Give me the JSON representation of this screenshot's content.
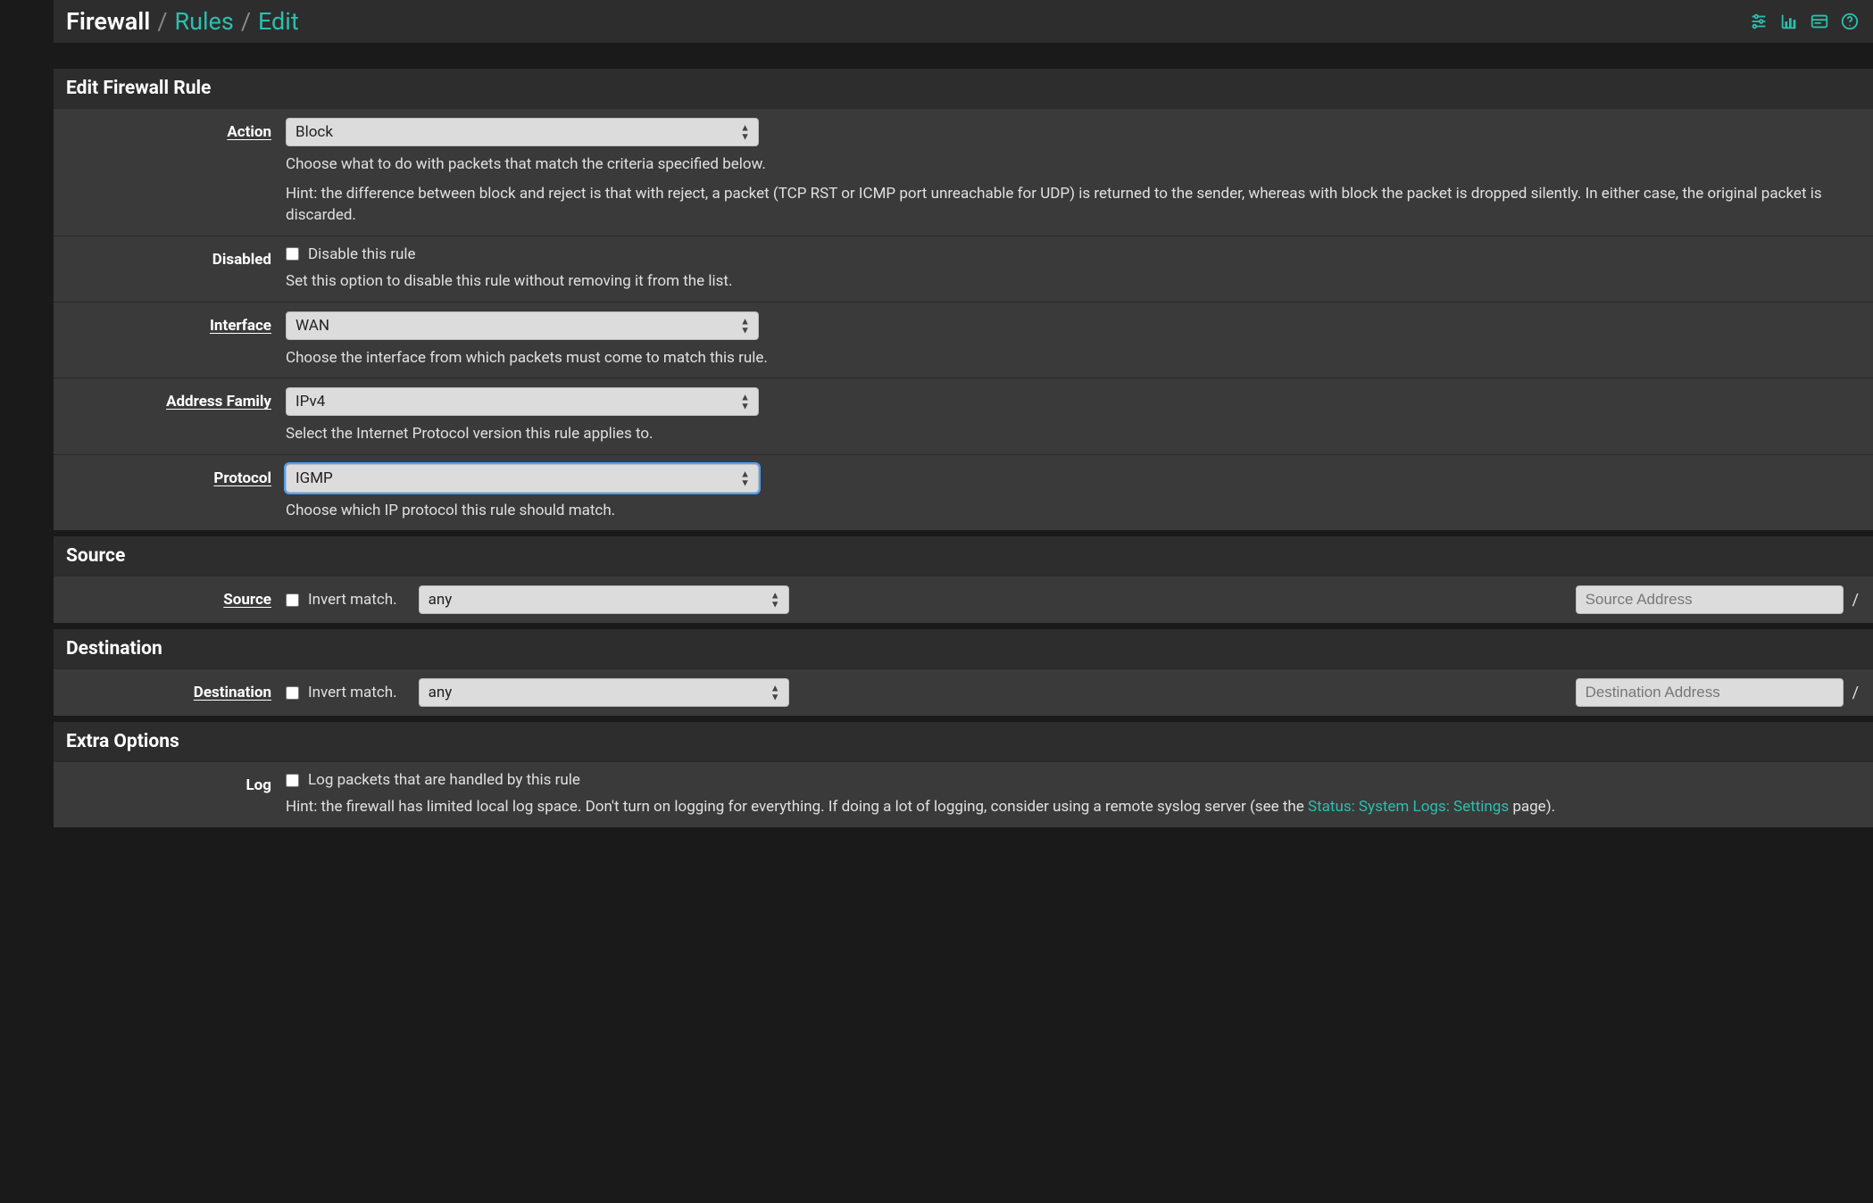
{
  "breadcrumb": {
    "root": "Firewall",
    "rules": "Rules",
    "edit": "Edit"
  },
  "panels": {
    "edit_rule": "Edit Firewall Rule",
    "source": "Source",
    "destination": "Destination",
    "extra_options": "Extra Options"
  },
  "labels": {
    "action": "Action",
    "disabled": "Disabled",
    "interface": "Interface",
    "address_family": "Address Family",
    "protocol": "Protocol",
    "source": "Source",
    "destination": "Destination",
    "log": "Log"
  },
  "action": {
    "value": "Block",
    "help": "Choose what to do with packets that match the criteria specified below.",
    "hint": "Hint: the difference between block and reject is that with reject, a packet (TCP RST or ICMP port unreachable for UDP) is returned to the sender, whereas with block the packet is dropped silently. In either case, the original packet is discarded."
  },
  "disabled": {
    "checkbox_label": "Disable this rule",
    "help": "Set this option to disable this rule without removing it from the list."
  },
  "interface": {
    "value": "WAN",
    "help": "Choose the interface from which packets must come to match this rule."
  },
  "address_family": {
    "value": "IPv4",
    "help": "Select the Internet Protocol version this rule applies to."
  },
  "protocol": {
    "value": "IGMP",
    "help": "Choose which IP protocol this rule should match."
  },
  "source": {
    "invert_label": "Invert match.",
    "type_value": "any",
    "address_placeholder": "Source Address"
  },
  "destination": {
    "invert_label": "Invert match.",
    "type_value": "any",
    "address_placeholder": "Destination Address"
  },
  "log": {
    "checkbox_label": "Log packets that are handled by this rule",
    "hint_before": "Hint: the firewall has limited local log space. Don't turn on logging for everything. If doing a lot of logging, consider using a remote syslog server (see the ",
    "link_text": "Status: System Logs: Settings",
    "hint_after": " page)."
  },
  "slash": "/"
}
